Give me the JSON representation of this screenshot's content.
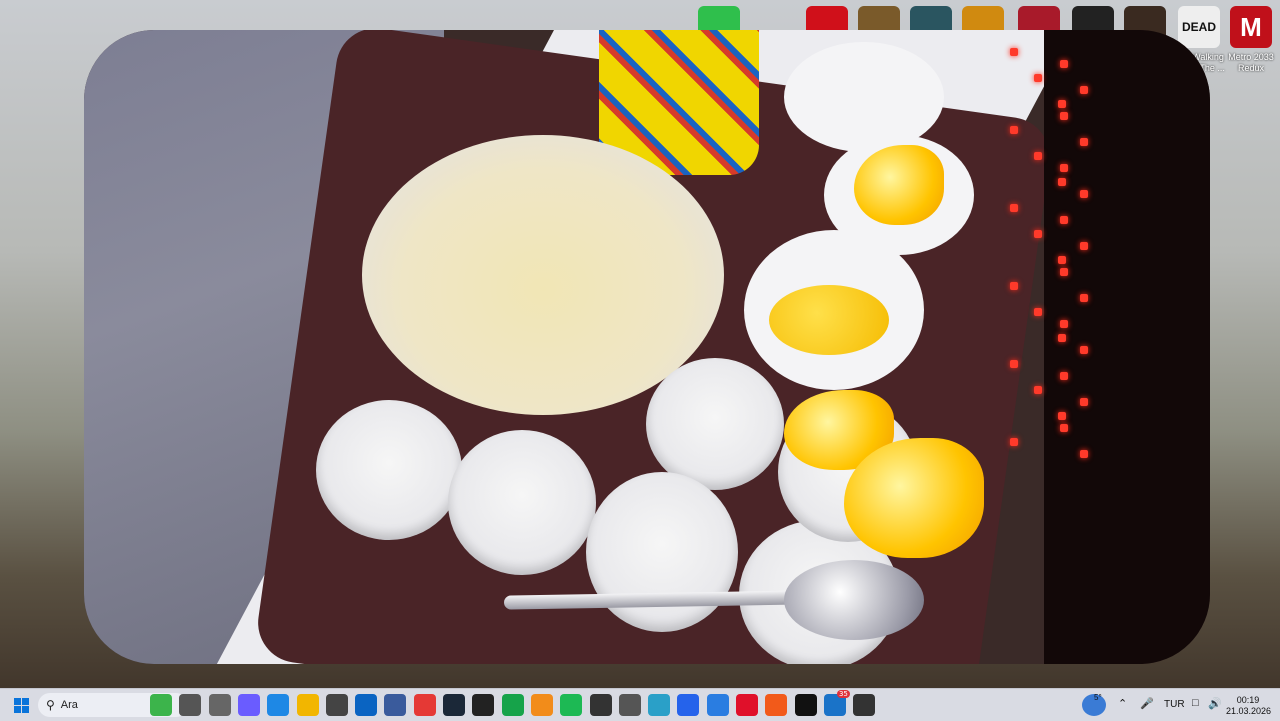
{
  "desktop": {
    "shortcuts": [
      {
        "name": "green-grid-app",
        "label": "",
        "color": "#2fbf4c"
      },
      {
        "name": "red-game-app",
        "label": "",
        "color": "#d0101a"
      },
      {
        "name": "half-life-app",
        "label": "",
        "color": "#7a5a2a"
      },
      {
        "name": "league-app",
        "label": "",
        "color": "#2a5560"
      },
      {
        "name": "star-trek-app",
        "label": "",
        "color": "#d08a10"
      },
      {
        "name": "spiderman-app",
        "label": "",
        "color": "#a81a2a"
      },
      {
        "name": "skull-app",
        "label": "",
        "color": "#222222"
      },
      {
        "name": "circle-app",
        "label": "",
        "color": "#3a2a20"
      },
      {
        "name": "walking-dead-shortcut",
        "label": "The Walking Dead: The ...",
        "badge": "DEAD",
        "color": "#eeeeee"
      },
      {
        "name": "metro-shortcut",
        "label": "Metro 2033 Redux",
        "badge": "M",
        "color": "#c0101a"
      }
    ]
  },
  "taskbar": {
    "search_placeholder": "Ara",
    "apps": [
      {
        "name": "widgets-icon",
        "color": "#3cb44b"
      },
      {
        "name": "task-view-icon",
        "color": "#555555"
      },
      {
        "name": "settings-gear-icon",
        "color": "#666666"
      },
      {
        "name": "copilot-icon",
        "color": "#6a5cff"
      },
      {
        "name": "edge-icon",
        "color": "#1e88e5"
      },
      {
        "name": "file-explorer-icon",
        "color": "#f2b600"
      },
      {
        "name": "store-icon",
        "color": "#444444"
      },
      {
        "name": "outlook-icon",
        "color": "#0a64c2"
      },
      {
        "name": "calculator-icon",
        "color": "#3a5b9c"
      },
      {
        "name": "chrome-icon",
        "color": "#e53935"
      },
      {
        "name": "steam-icon",
        "color": "#1b2838"
      },
      {
        "name": "epic-games-icon",
        "color": "#222222"
      },
      {
        "name": "xbox-icon",
        "color": "#16a34a"
      },
      {
        "name": "sublime-icon",
        "color": "#f28c1a"
      },
      {
        "name": "spotify-icon",
        "color": "#1db954"
      },
      {
        "name": "obs-icon",
        "color": "#333333"
      },
      {
        "name": "clock-icon",
        "color": "#555555"
      },
      {
        "name": "globe-icon",
        "color": "#2aa0c8"
      },
      {
        "name": "todo-icon",
        "color": "#2563eb"
      },
      {
        "name": "signal-icon",
        "color": "#2a7de1"
      },
      {
        "name": "opera-icon",
        "color": "#e0102a"
      },
      {
        "name": "brave-icon",
        "color": "#f25a1a"
      },
      {
        "name": "tiktok-icon",
        "color": "#111111"
      },
      {
        "name": "mail-icon",
        "color": "#1a73c8",
        "badge": "35"
      },
      {
        "name": "terminal-icon",
        "color": "#333333"
      }
    ],
    "tray": {
      "weather_temp": "5°",
      "language": "TUR",
      "time": "00:19",
      "date": "21.03.2026"
    }
  }
}
